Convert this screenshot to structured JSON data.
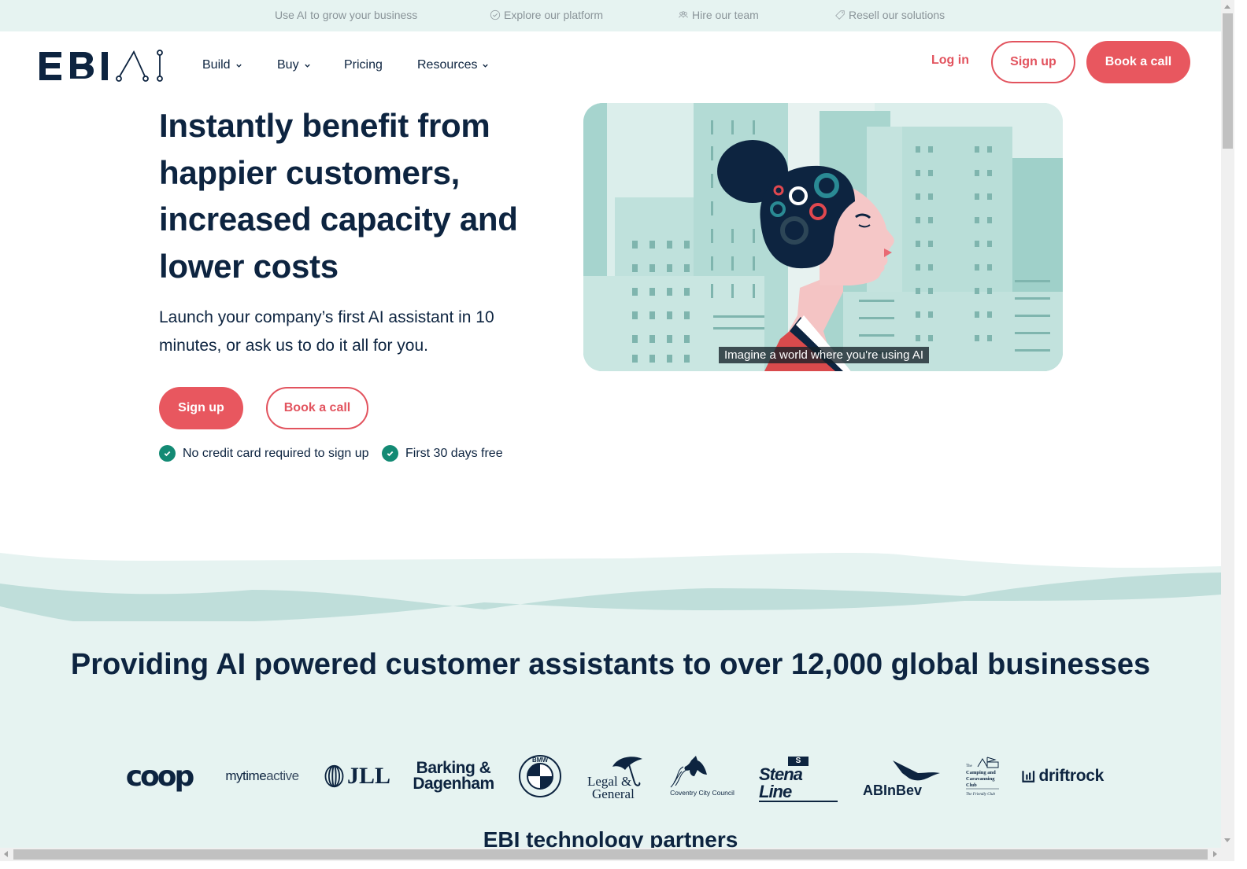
{
  "topbar": {
    "items": [
      {
        "label": "Use AI to grow your business",
        "icon": "none"
      },
      {
        "label": "Explore our platform",
        "icon": "badge-check-icon"
      },
      {
        "label": "Hire our team",
        "icon": "people-icon"
      },
      {
        "label": "Resell our solutions",
        "icon": "tag-icon"
      }
    ]
  },
  "header": {
    "logo_text": "EBI.AI",
    "nav": [
      {
        "label": "Build",
        "has_dropdown": true
      },
      {
        "label": "Buy",
        "has_dropdown": true
      },
      {
        "label": "Pricing",
        "has_dropdown": false
      },
      {
        "label": "Resources",
        "has_dropdown": true
      }
    ],
    "login_label": "Log in",
    "signup_label": "Sign up",
    "book_label": "Book a call"
  },
  "hero": {
    "title": "Instantly benefit from happier customers, increased capacity and lower costs",
    "subtitle": "Launch your company’s first AI assistant in 10 minutes, or ask us to do it all for you.",
    "signup_label": "Sign up",
    "book_label": "Book a call",
    "checks": [
      "No credit card required to sign up",
      "First 30 days free"
    ],
    "video_caption": "Imagine a world where you're using AI"
  },
  "customers": {
    "title": "Providing AI powered customer assistants to over 12,000 global businesses",
    "logos": [
      "coop",
      "mytimeactive",
      "JLL",
      "Barking & Dagenham",
      "BMW",
      "Legal & General",
      "Coventry City Council",
      "Stena Line",
      "ABInBev",
      "The Camping and Caravanning Club",
      "driftrock"
    ],
    "logo_sub": {
      "mytime": "mytime",
      "active": "active",
      "barking_1": "Barking &",
      "barking_2": "Dagenham",
      "legal_1": "Legal &",
      "legal_2": "General",
      "coventry": "Coventry City Council",
      "stena": "Stena Line",
      "camping_1": "The",
      "camping_2": "Camping and",
      "camping_3": "Caravanning",
      "camping_4": "Club",
      "camping_5": "The Friendly Club"
    }
  },
  "partners": {
    "title": "EBI technology partners"
  },
  "colors": {
    "brand_navy": "#0d2440",
    "accent_red": "#e8575f",
    "teal_bg": "#e6f3f1",
    "check_green": "#138a74"
  }
}
